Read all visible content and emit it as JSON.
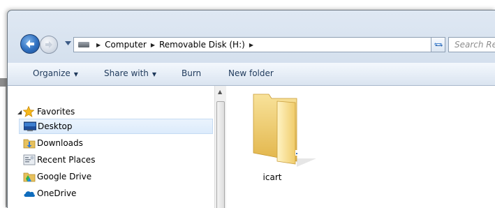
{
  "address": {
    "crumbs": [
      "Computer",
      "Removable Disk (H:)"
    ]
  },
  "search": {
    "placeholder": "Search Rem"
  },
  "toolbar": {
    "organize": "Organize",
    "share_with": "Share with",
    "burn": "Burn",
    "new_folder": "New folder"
  },
  "nav_pane": {
    "favorites": "Favorites",
    "items": [
      {
        "label": "Desktop",
        "icon": "desktop-icon",
        "selected": true
      },
      {
        "label": "Downloads",
        "icon": "downloads-folder-icon"
      },
      {
        "label": "Recent Places",
        "icon": "recent-places-icon"
      },
      {
        "label": "Google Drive",
        "icon": "google-drive-icon"
      },
      {
        "label": "OneDrive",
        "icon": "onedrive-icon"
      }
    ]
  },
  "content": {
    "items": [
      {
        "name": "icart",
        "icon": "folder-icon"
      }
    ]
  },
  "colors": {
    "toolbar_text": "#1e395b",
    "selection_bg": "#dcebfc",
    "folder": "#f3d67a"
  }
}
